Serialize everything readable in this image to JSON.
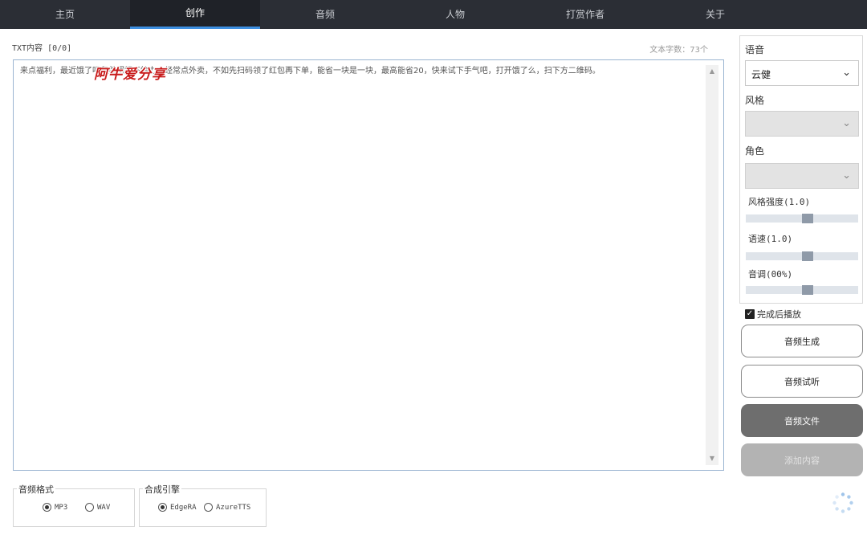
{
  "nav": {
    "tabs": [
      {
        "label": "主页",
        "active": false
      },
      {
        "label": "创作",
        "active": true
      },
      {
        "label": "音频",
        "active": false
      },
      {
        "label": "人物",
        "active": false
      },
      {
        "label": "打赏作者",
        "active": false
      },
      {
        "label": "关于",
        "active": false
      }
    ]
  },
  "editor": {
    "txt_label": "TXT内容 [0/0]",
    "char_count": "文本字数：73个",
    "content": "来点福利，最近饿了吗和美团都不给力，经常点外卖，不如先扫码领了红包再下单，能省一块是一块，最高能省20，快来试下手气吧，打开饿了么，扫下方二维码。",
    "watermark": "阿牛爱分享"
  },
  "audio_format": {
    "legend": "音频格式",
    "options": [
      {
        "label": "MP3",
        "selected": true
      },
      {
        "label": "WAV",
        "selected": false
      }
    ]
  },
  "engine": {
    "legend": "合成引擎",
    "options": [
      {
        "label": "EdgeRA",
        "selected": true
      },
      {
        "label": "AzureTTS",
        "selected": false
      }
    ]
  },
  "panel": {
    "voice_label": "语音",
    "voice_value": "云健",
    "style_label": "风格",
    "style_value": "",
    "role_label": "角色",
    "role_value": "",
    "style_strength_label": "风格强度(1.0)",
    "style_strength": 0.55,
    "speed_label": "语速(1.0)",
    "speed": 0.55,
    "pitch_label": "音调(00%)",
    "pitch": 0.55
  },
  "play_after": {
    "label": "完成后播放",
    "checked": true
  },
  "buttons": {
    "generate": "音频生成",
    "preview": "音频试听",
    "file": "音频文件",
    "add": "添加内容"
  },
  "colors": {
    "nav_bg": "#2b2e35",
    "active_underline": "#3d8fe0",
    "watermark": "#c81b1b"
  }
}
